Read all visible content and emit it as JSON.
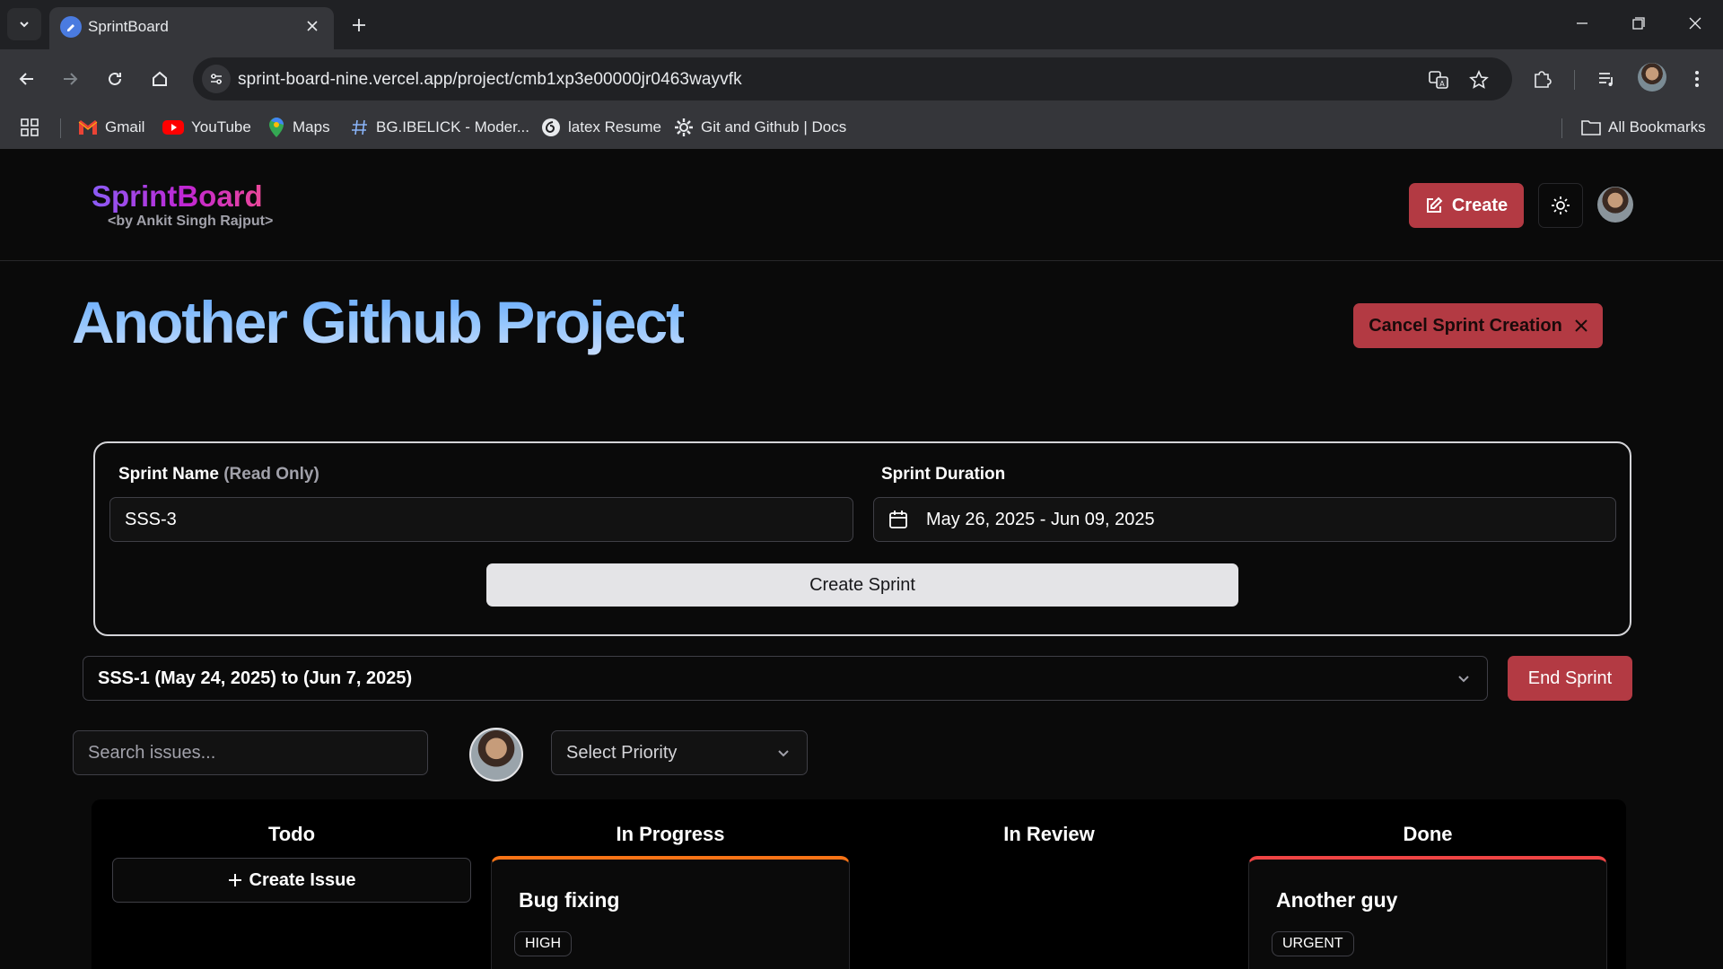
{
  "browser": {
    "tab_title": "SprintBoard",
    "url": "sprint-board-nine.vercel.app/project/cmb1xp3e00000jr0463wayvfk",
    "bookmarks": [
      {
        "label": "Gmail",
        "icon": "gmail-icon"
      },
      {
        "label": "YouTube",
        "icon": "youtube-icon"
      },
      {
        "label": "Maps",
        "icon": "maps-icon"
      },
      {
        "label": "BG.IBELICK - Moder...",
        "icon": "hash-icon"
      },
      {
        "label": "latex Resume",
        "icon": "overleaf-icon"
      },
      {
        "label": "Git and Github | Docs",
        "icon": "gear-icon"
      }
    ],
    "all_bookmarks": "All Bookmarks"
  },
  "app": {
    "logo": "SprintBoard",
    "logo_sub": "<by Ankit Singh Rajput>",
    "create_label": "Create"
  },
  "project": {
    "title": "Another Github Project",
    "cancel_label": "Cancel Sprint Creation"
  },
  "sprint_form": {
    "name_label": "Sprint Name",
    "name_hint": "(Read Only)",
    "name_value": "SSS-3",
    "duration_label": "Sprint Duration",
    "duration_value": "May 26, 2025 - Jun 09, 2025",
    "submit_label": "Create Sprint"
  },
  "sprint_bar": {
    "selected": "SSS-1 (May 24, 2025) to (Jun 7, 2025)",
    "end_label": "End Sprint"
  },
  "filters": {
    "search_placeholder": "Search issues...",
    "priority_placeholder": "Select Priority"
  },
  "board": {
    "columns": [
      "Todo",
      "In Progress",
      "In Review",
      "Done"
    ],
    "create_issue_label": "Create Issue",
    "cards": [
      {
        "column": "In Progress",
        "title": "Bug fixing",
        "priority": "HIGH",
        "accent": "#f97316"
      },
      {
        "column": "Done",
        "title": "Another guy",
        "priority": "URGENT",
        "accent": "#ef4444"
      }
    ]
  },
  "colors": {
    "accent_red": "#b33a43",
    "title_blue": "#93c5fd",
    "logo_purple": "#8b5cf6",
    "logo_pink": "#ec4899"
  }
}
